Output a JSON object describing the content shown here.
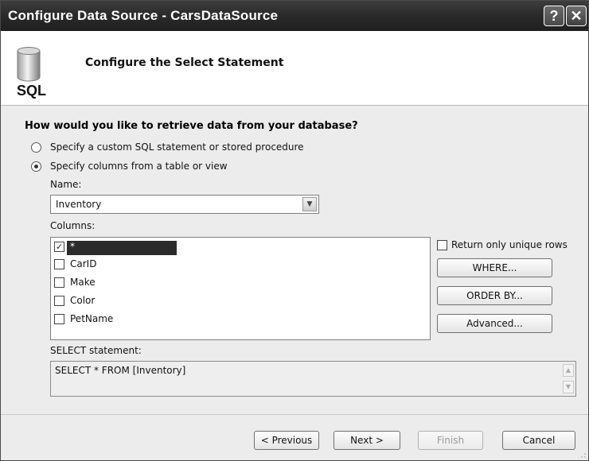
{
  "window": {
    "title": "Configure Data Source - CarsDataSource",
    "help_label": "?",
    "close_label": "✕"
  },
  "header": {
    "icon": "database-icon",
    "icon_label": "SQL",
    "title": "Configure the Select Statement"
  },
  "main": {
    "question": "How would you like to retrieve data from your database?",
    "options": [
      {
        "label": "Specify a custom SQL statement or stored procedure",
        "selected": false
      },
      {
        "label": "Specify columns from a table or view",
        "selected": true
      }
    ],
    "name_label": "Name:",
    "name_value": "Inventory",
    "columns_label": "Columns:",
    "columns": [
      {
        "label": "*",
        "checked": true,
        "selected": true
      },
      {
        "label": "CarID",
        "checked": false
      },
      {
        "label": "Make",
        "checked": false
      },
      {
        "label": "Color",
        "checked": false
      },
      {
        "label": "PetName",
        "checked": false
      }
    ],
    "unique_rows_label": "Return only unique rows",
    "side_buttons": {
      "where": "WHERE...",
      "order_by": "ORDER BY...",
      "advanced": "Advanced..."
    },
    "select_statement_label": "SELECT statement:",
    "select_statement": "SELECT * FROM [Inventory]"
  },
  "footer": {
    "previous": "< Previous",
    "next": "Next >",
    "finish": "Finish",
    "cancel": "Cancel"
  }
}
